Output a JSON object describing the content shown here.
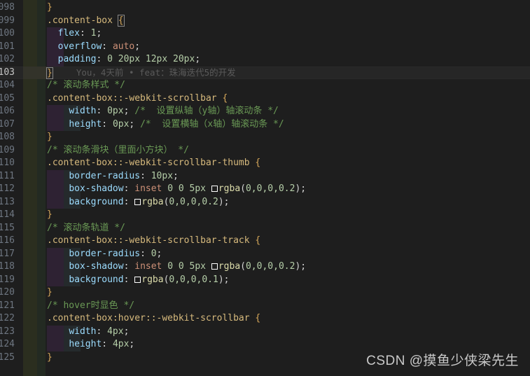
{
  "app": {
    "name": "code-editor",
    "theme": "dark-plus"
  },
  "watermark": {
    "text": "CSDN @摸鱼少侠梁先生"
  },
  "blame": {
    "text": "You，4天前 • feat：珠海迭代5的开发"
  },
  "lines": [
    {
      "no": "098",
      "tokens": [
        {
          "t": "brace",
          "v": "}"
        }
      ]
    },
    {
      "no": "099",
      "tokens": [
        {
          "t": "sel",
          "v": ".content-box "
        },
        {
          "t": "brace-box",
          "v": "{"
        }
      ]
    },
    {
      "no": "100",
      "indent": 1,
      "tokens": [
        {
          "t": "sp",
          "v": "  "
        },
        {
          "t": "prop",
          "v": "flex"
        },
        {
          "t": "punc",
          "v": ": "
        },
        {
          "t": "num",
          "v": "1"
        },
        {
          "t": "punc",
          "v": ";"
        }
      ]
    },
    {
      "no": "101",
      "indent": 1,
      "tokens": [
        {
          "t": "sp",
          "v": "  "
        },
        {
          "t": "prop",
          "v": "overflow"
        },
        {
          "t": "punc",
          "v": ": "
        },
        {
          "t": "kw",
          "v": "auto"
        },
        {
          "t": "punc",
          "v": ";"
        }
      ]
    },
    {
      "no": "102",
      "indent": 1,
      "tokens": [
        {
          "t": "sp",
          "v": "  "
        },
        {
          "t": "prop",
          "v": "padding"
        },
        {
          "t": "punc",
          "v": ": "
        },
        {
          "t": "num",
          "v": "0 20px 12px 20px"
        },
        {
          "t": "punc",
          "v": ";"
        }
      ]
    },
    {
      "no": "103",
      "active": true,
      "tokens": [
        {
          "t": "brace-box",
          "v": "}"
        },
        {
          "t": "blame",
          "v": "You，4天前 • feat：珠海迭代5的开发"
        }
      ]
    },
    {
      "no": "104",
      "tokens": [
        {
          "t": "cmt",
          "v": "/* 滚动条样式 */"
        }
      ]
    },
    {
      "no": "105",
      "tokens": [
        {
          "t": "sel",
          "v": ".content-box::-webkit-scrollbar "
        },
        {
          "t": "brace",
          "v": "{"
        }
      ]
    },
    {
      "no": "106",
      "indent": 2,
      "tokens": [
        {
          "t": "sp",
          "v": "    "
        },
        {
          "t": "prop",
          "v": "width"
        },
        {
          "t": "punc",
          "v": ": "
        },
        {
          "t": "num",
          "v": "0px"
        },
        {
          "t": "punc",
          "v": "; "
        },
        {
          "t": "cmt",
          "v": "/*  设置纵轴（y轴）轴滚动条 */"
        }
      ]
    },
    {
      "no": "107",
      "indent": 2,
      "tokens": [
        {
          "t": "sp",
          "v": "    "
        },
        {
          "t": "prop",
          "v": "height"
        },
        {
          "t": "punc",
          "v": ": "
        },
        {
          "t": "num",
          "v": "0px"
        },
        {
          "t": "punc",
          "v": "; "
        },
        {
          "t": "cmt",
          "v": "/*  设置横轴（x轴）轴滚动条 */"
        }
      ]
    },
    {
      "no": "108",
      "tokens": [
        {
          "t": "brace",
          "v": "}"
        }
      ]
    },
    {
      "no": "109",
      "tokens": [
        {
          "t": "cmt",
          "v": "/* 滚动条滑块（里面小方块） */"
        }
      ]
    },
    {
      "no": "110",
      "tokens": [
        {
          "t": "sel",
          "v": ".content-box::-webkit-scrollbar-thumb "
        },
        {
          "t": "brace",
          "v": "{"
        }
      ]
    },
    {
      "no": "111",
      "indent": 2,
      "tokens": [
        {
          "t": "sp",
          "v": "    "
        },
        {
          "t": "prop",
          "v": "border-radius"
        },
        {
          "t": "punc",
          "v": ": "
        },
        {
          "t": "num",
          "v": "10px"
        },
        {
          "t": "punc",
          "v": ";"
        }
      ]
    },
    {
      "no": "112",
      "indent": 2,
      "tokens": [
        {
          "t": "sp",
          "v": "    "
        },
        {
          "t": "prop",
          "v": "box-shadow"
        },
        {
          "t": "punc",
          "v": ": "
        },
        {
          "t": "kw",
          "v": "inset"
        },
        {
          "t": "punc",
          "v": " "
        },
        {
          "t": "num",
          "v": "0 0 5px"
        },
        {
          "t": "punc",
          "v": " "
        },
        {
          "t": "swatch",
          "v": ""
        },
        {
          "t": "fn",
          "v": "rgba"
        },
        {
          "t": "punc",
          "v": "("
        },
        {
          "t": "num",
          "v": "0,0,0,0.2"
        },
        {
          "t": "punc",
          "v": ");"
        }
      ]
    },
    {
      "no": "113",
      "indent": 2,
      "tokens": [
        {
          "t": "sp",
          "v": "    "
        },
        {
          "t": "prop",
          "v": "background"
        },
        {
          "t": "punc",
          "v": ": "
        },
        {
          "t": "swatch",
          "v": ""
        },
        {
          "t": "fn",
          "v": "rgba"
        },
        {
          "t": "punc",
          "v": "("
        },
        {
          "t": "num",
          "v": "0,0,0,0.2"
        },
        {
          "t": "punc",
          "v": ");"
        }
      ]
    },
    {
      "no": "114",
      "tokens": [
        {
          "t": "brace",
          "v": "}"
        }
      ]
    },
    {
      "no": "115",
      "tokens": [
        {
          "t": "cmt",
          "v": "/* 滚动条轨道 */"
        }
      ]
    },
    {
      "no": "116",
      "tokens": [
        {
          "t": "sel",
          "v": ".content-box::-webkit-scrollbar-track "
        },
        {
          "t": "brace",
          "v": "{"
        }
      ]
    },
    {
      "no": "117",
      "indent": 2,
      "tokens": [
        {
          "t": "sp",
          "v": "    "
        },
        {
          "t": "prop",
          "v": "border-radius"
        },
        {
          "t": "punc",
          "v": ": "
        },
        {
          "t": "num",
          "v": "0"
        },
        {
          "t": "punc",
          "v": ";"
        }
      ]
    },
    {
      "no": "118",
      "indent": 2,
      "tokens": [
        {
          "t": "sp",
          "v": "    "
        },
        {
          "t": "prop",
          "v": "box-shadow"
        },
        {
          "t": "punc",
          "v": ": "
        },
        {
          "t": "kw",
          "v": "inset"
        },
        {
          "t": "punc",
          "v": " "
        },
        {
          "t": "num",
          "v": "0 0 5px"
        },
        {
          "t": "punc",
          "v": " "
        },
        {
          "t": "swatch",
          "v": ""
        },
        {
          "t": "fn",
          "v": "rgba"
        },
        {
          "t": "punc",
          "v": "("
        },
        {
          "t": "num",
          "v": "0,0,0,0.2"
        },
        {
          "t": "punc",
          "v": ");"
        }
      ]
    },
    {
      "no": "119",
      "indent": 2,
      "tokens": [
        {
          "t": "sp",
          "v": "    "
        },
        {
          "t": "prop",
          "v": "background"
        },
        {
          "t": "punc",
          "v": ": "
        },
        {
          "t": "swatch",
          "v": ""
        },
        {
          "t": "fn",
          "v": "rgba"
        },
        {
          "t": "punc",
          "v": "("
        },
        {
          "t": "num",
          "v": "0,0,0,0.1"
        },
        {
          "t": "punc",
          "v": ");"
        }
      ]
    },
    {
      "no": "120",
      "tokens": [
        {
          "t": "brace",
          "v": "}"
        }
      ]
    },
    {
      "no": "121",
      "tokens": [
        {
          "t": "cmt",
          "v": "/* hover时显色 */"
        }
      ]
    },
    {
      "no": "122",
      "tokens": [
        {
          "t": "sel",
          "v": ".content-box:hover::-webkit-scrollbar "
        },
        {
          "t": "brace",
          "v": "{"
        }
      ]
    },
    {
      "no": "123",
      "indent": 2,
      "tokens": [
        {
          "t": "sp",
          "v": "    "
        },
        {
          "t": "prop",
          "v": "width"
        },
        {
          "t": "punc",
          "v": ": "
        },
        {
          "t": "num",
          "v": "4px"
        },
        {
          "t": "punc",
          "v": ";"
        }
      ]
    },
    {
      "no": "124",
      "indent": 2,
      "tokens": [
        {
          "t": "sp",
          "v": "    "
        },
        {
          "t": "prop",
          "v": "height"
        },
        {
          "t": "punc",
          "v": ": "
        },
        {
          "t": "num",
          "v": "4px"
        },
        {
          "t": "punc",
          "v": ";"
        }
      ]
    },
    {
      "no": "125",
      "tokens": [
        {
          "t": "brace",
          "v": "}"
        }
      ]
    }
  ],
  "colors": {
    "editor_bg": "#1e1e1e",
    "line_highlight": "#262626",
    "comment": "#6a9955",
    "selector": "#d7ba7d",
    "property": "#9cdcfe",
    "number": "#b5cea8",
    "keyword": "#ce9178",
    "function": "#dcdcaa",
    "linenumber": "#6e7681",
    "gutter_modified": "#2b2e1f",
    "indent_guide": "#2e2233"
  }
}
